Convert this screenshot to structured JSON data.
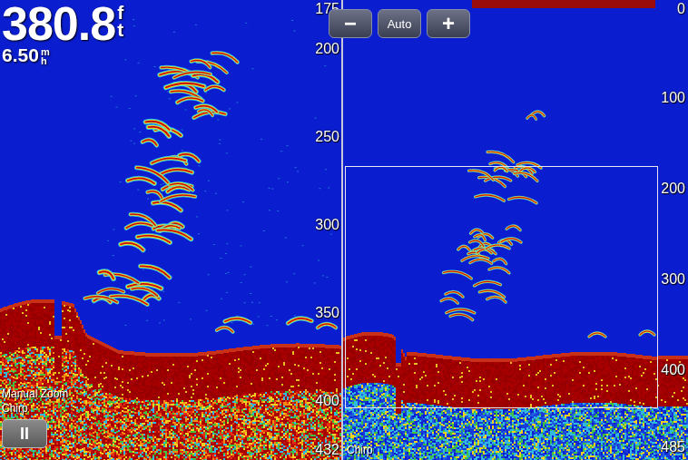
{
  "depth": {
    "value": "380.8",
    "unit_top": "f",
    "unit_bottom": "t"
  },
  "speed": {
    "value": "6.50",
    "unit_top": "m",
    "unit_bottom": "h"
  },
  "zoom_controls": [
    {
      "label": "−"
    },
    {
      "label": "Auto"
    },
    {
      "label": "+"
    }
  ],
  "left_panel": {
    "mode": "Manual Zoom",
    "frequency": "Chirp",
    "pause": "II",
    "scale": [
      "175",
      "200",
      "250",
      "300",
      "350",
      "400",
      "432"
    ]
  },
  "right_panel": {
    "frequency": "Chirp",
    "scale": [
      "0",
      "100",
      "200",
      "300",
      "400",
      "485"
    ]
  }
}
